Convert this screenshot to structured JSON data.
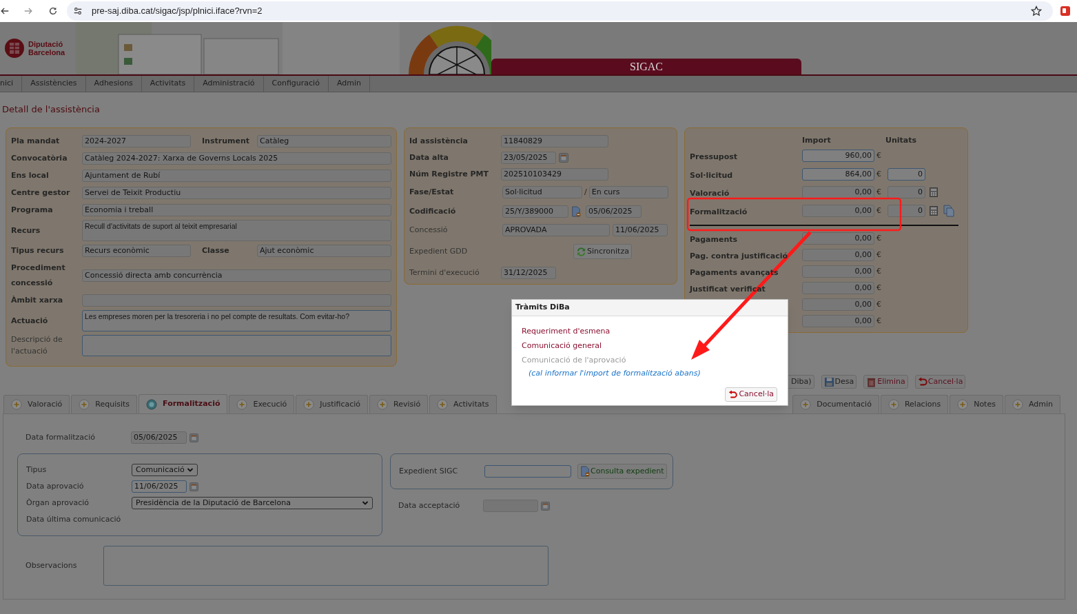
{
  "browser": {
    "url": "pre-saj.diba.cat/sigac/jsp/plnici.iface?rvn=2"
  },
  "header": {
    "logo_lines": [
      "Diputació",
      "Barcelona"
    ],
    "app_title": "SIGAC"
  },
  "menu": [
    "nici",
    "Assistències",
    "Adhesions",
    "Activitats",
    "Administració",
    "Configuració",
    "Admin"
  ],
  "page_title": "Detall de l'assistència",
  "general": {
    "rows": [
      {
        "kind": "pair",
        "label": "Pla mandat",
        "bold": true,
        "value": "2024-2027",
        "label2": "Instrument",
        "value2": "Catàleg",
        "editable": false
      },
      {
        "kind": "single",
        "label": "Convocatòria",
        "bold": true,
        "value": "Catàleg 2024-2027: Xarxa de Governs Locals 2025",
        "editable": false
      },
      {
        "kind": "single",
        "label": "Ens local",
        "bold": true,
        "value": "Ajuntament de Rubí",
        "editable": false
      },
      {
        "kind": "single",
        "label": "Centre gestor",
        "bold": true,
        "value": "Servei de Teixit Productiu",
        "editable": false
      },
      {
        "kind": "single",
        "label": "Programa",
        "bold": true,
        "value": "Economia i treball",
        "editable": false
      },
      {
        "kind": "textarea",
        "label": "Recurs",
        "bold": true,
        "value": "Recull d'activitats de suport al teixit empresarial",
        "editable": false
      },
      {
        "kind": "pair",
        "label": "Tipus recurs",
        "bold": true,
        "value": "Recurs econòmic",
        "label2": "Classe",
        "value2": "Ajut econòmic",
        "editable": false
      },
      {
        "kind": "single",
        "label": "Procediment concessió",
        "bold": true,
        "value": "Concessió directa amb concurrència",
        "editable": false
      },
      {
        "kind": "single",
        "label": "Àmbit xarxa",
        "bold": true,
        "editable": false
      },
      {
        "kind": "textarea",
        "label": "Actuació",
        "bold": true,
        "value": "Les empreses moren per la tresoreria i no pel compte de resultats. Com evitar-ho?",
        "editable": true
      },
      {
        "kind": "textarea",
        "label": "Descripció de l'actuació",
        "bold": false,
        "editable": true
      }
    ]
  },
  "identification": {
    "rows": [
      {
        "kind": "text",
        "label": "Id assistència",
        "bold": true,
        "values": [
          "11840829"
        ]
      },
      {
        "kind": "date",
        "label": "Data alta",
        "bold": true,
        "values": [
          "23/05/2025"
        ]
      },
      {
        "kind": "text",
        "label": "Núm Registre PMT",
        "bold": true,
        "values": [
          "202510103429"
        ]
      },
      {
        "kind": "split",
        "label": "Fase/Estat",
        "bold": true,
        "values": [
          "Sol·licitud",
          "En curs"
        ],
        "separator": "/"
      },
      {
        "kind": "code",
        "label": "Codificació",
        "bold": true,
        "values": [
          "25/Y/389000",
          "05/06/2025"
        ]
      },
      {
        "kind": "pair",
        "label": "Concessió",
        "bold": false,
        "values": [
          "APROVADA",
          "11/06/2025"
        ]
      },
      {
        "kind": "button",
        "label": "Expedient GDD",
        "bold": false,
        "button": "Sincronitza"
      },
      {
        "kind": "short",
        "label": "Termini d'execució",
        "bold": false,
        "values": [
          "31/12/2025"
        ]
      }
    ]
  },
  "amounts": {
    "columns": [
      "Import",
      "Unitats"
    ],
    "rows": [
      {
        "kind": "amount",
        "label": "Pressupost",
        "amount": "960,00",
        "currency": "€",
        "editable": true
      },
      {
        "kind": "amount",
        "label": "Sol·licitud",
        "amount": "864,00",
        "currency": "€",
        "editable": true,
        "units": "0",
        "units_editable": true
      },
      {
        "kind": "amount",
        "label": "Valoració",
        "amount": "0,00",
        "currency": "€",
        "editable": false,
        "units": "0",
        "units_editable": false,
        "calculator": true
      },
      {
        "kind": "amount",
        "label": "Formalització",
        "amount": "0,00",
        "currency": "€",
        "editable": false,
        "units": "0",
        "units_editable": false,
        "calculator": true,
        "copy": true
      },
      {
        "kind": "separator"
      },
      {
        "kind": "amount",
        "label": "Pagaments",
        "amount": "0,00",
        "currency": "€",
        "editable": false
      },
      {
        "kind": "amount",
        "label": "Pag. contra justificació",
        "amount": "0,00",
        "currency": "€",
        "editable": false
      },
      {
        "kind": "amount",
        "label": "Pagaments avançats",
        "amount": "0,00",
        "currency": "€",
        "editable": false
      },
      {
        "kind": "amount",
        "label": "Justificat verificat",
        "amount": "0,00",
        "currency": "€",
        "editable": false
      },
      {
        "kind": "amount",
        "amount": "0,00",
        "currency": "€",
        "editable": false
      },
      {
        "kind": "amount",
        "amount": "0,00",
        "currency": "€",
        "editable": false
      }
    ]
  },
  "actions": [
    {
      "kind": "plain",
      "label": "Diba)"
    },
    {
      "kind": "save",
      "label": "Desa"
    },
    {
      "kind": "delete",
      "label": "Elimina"
    },
    {
      "kind": "cancel",
      "label": "Cancel·la"
    }
  ],
  "tabs_left": [
    {
      "label": "Valoració",
      "selected": false
    },
    {
      "label": "Requisits",
      "selected": false
    },
    {
      "label": "Formalització",
      "selected": true
    },
    {
      "label": "Execució",
      "selected": false
    },
    {
      "label": "Justificació",
      "selected": false
    },
    {
      "label": "Revisió",
      "selected": false
    },
    {
      "label": "Activitats",
      "selected": false
    }
  ],
  "tabs_right": [
    {
      "label": "Documentació",
      "selected": false
    },
    {
      "label": "Relacions",
      "selected": false
    },
    {
      "label": "Notes",
      "selected": false
    },
    {
      "label": "Admin",
      "selected": false
    }
  ],
  "formalization": {
    "date_label": "Data formalització",
    "date_value": "05/06/2025",
    "approval": [
      {
        "kind": "select",
        "label": "Tipus",
        "value": "Comunicació"
      },
      {
        "kind": "date",
        "label": "Data aprovació",
        "value": "11/06/2025"
      },
      {
        "kind": "select_wide",
        "label": "Òrgan aprovació",
        "value": "Presidència de la Diputació de Barcelona"
      },
      {
        "kind": "empty",
        "label": "Data última comunicació"
      }
    ],
    "sigc": {
      "label": "Expedient SIGC",
      "button": "Consulta expedient"
    },
    "acceptance": {
      "label": "Data acceptació",
      "disabled": true
    },
    "observations_label": "Observacions"
  },
  "modal": {
    "title": "Tràmits DiBa",
    "links": [
      {
        "label": "Requeriment d'esmena",
        "disabled": false
      },
      {
        "label": "Comunicació general",
        "disabled": false
      },
      {
        "label": "Comunicació de l'aprovació",
        "disabled": true
      }
    ],
    "note": "(cal informar l'import de formalització abans)",
    "cancel": "Cancel·la"
  }
}
